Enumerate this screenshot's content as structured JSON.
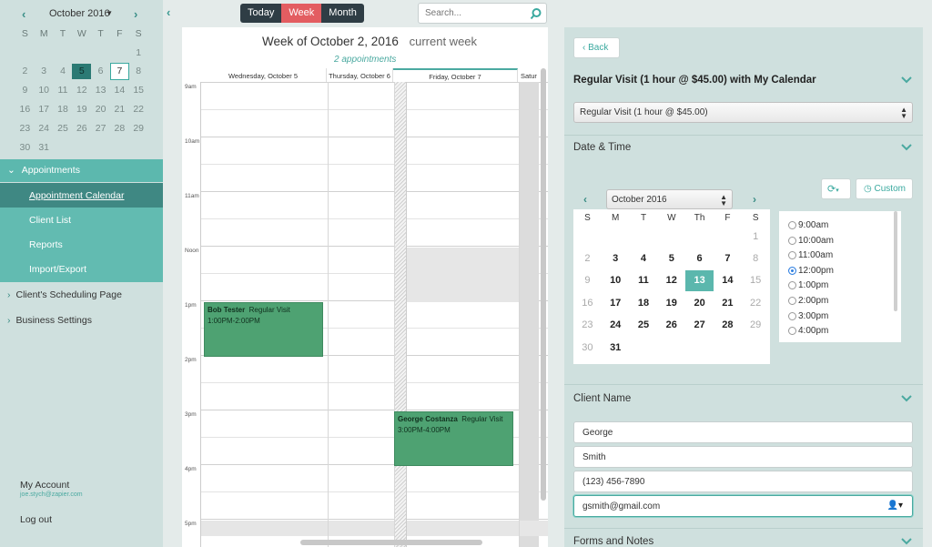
{
  "mini_calendar": {
    "month_label": "October 2016",
    "dow": [
      "S",
      "M",
      "T",
      "W",
      "T",
      "F",
      "S"
    ],
    "weeks": [
      [
        "",
        "",
        "",
        "",
        "",
        "",
        "1"
      ],
      [
        "2",
        "3",
        "4",
        "5",
        "6",
        "7",
        "8"
      ],
      [
        "9",
        "10",
        "11",
        "12",
        "13",
        "14",
        "15"
      ],
      [
        "16",
        "17",
        "18",
        "19",
        "20",
        "21",
        "22"
      ],
      [
        "23",
        "24",
        "25",
        "26",
        "27",
        "28",
        "29"
      ],
      [
        "30",
        "31",
        "",
        "",
        "",
        "",
        ""
      ]
    ],
    "selected_day": "5",
    "today_day": "7"
  },
  "sidebar": {
    "appointments_label": "Appointments",
    "sub_items": [
      "Appointment Calendar",
      "Client List",
      "Reports",
      "Import/Export"
    ],
    "scheduling_page_label": "Client's Scheduling Page",
    "business_settings_label": "Business Settings",
    "my_account_label": "My Account",
    "email": "joe.stych@zapier.com",
    "logout_label": "Log out"
  },
  "toolbar": {
    "today_label": "Today",
    "week_label": "Week",
    "month_label": "Month",
    "search_placeholder": "Search..."
  },
  "calendar": {
    "week_title": "Week of October 2, 2016",
    "current_week_label": "current week",
    "appointments_count": "2 appointments",
    "days": [
      "Wednesday, October 5",
      "Thursday, October 6",
      "Friday, October 7",
      "Satur"
    ],
    "time_labels": [
      "9am",
      "10am",
      "11am",
      "Noon",
      "1pm",
      "2pm",
      "3pm",
      "4pm",
      "5pm"
    ],
    "events": [
      {
        "name": "Bob Tester",
        "type": "Regular Visit",
        "time": "1:00PM-2:00PM"
      },
      {
        "name": "George Costanza",
        "type": "Regular Visit",
        "time": "3:00PM-4:00PM"
      }
    ]
  },
  "booking": {
    "back_label": "Back",
    "service_title": "Regular Visit (1 hour @ $45.00) with My Calendar",
    "service_select_value": "Regular Visit (1 hour @ $45.00)",
    "datetime_title": "Date & Time",
    "custom_label": "Custom",
    "picker_month": "October 2016",
    "picker_dow": [
      "S",
      "M",
      "T",
      "W",
      "Th",
      "F",
      "S"
    ],
    "picker_weeks": [
      [
        "",
        "",
        "",
        "",
        "",
        "",
        "1"
      ],
      [
        "2",
        "3",
        "4",
        "5",
        "6",
        "7",
        "8"
      ],
      [
        "9",
        "10",
        "11",
        "12",
        "13",
        "14",
        "15"
      ],
      [
        "16",
        "17",
        "18",
        "19",
        "20",
        "21",
        "22"
      ],
      [
        "23",
        "24",
        "25",
        "26",
        "27",
        "28",
        "29"
      ],
      [
        "30",
        "31",
        "",
        "",
        "",
        "",
        ""
      ]
    ],
    "available_days": [
      "3",
      "4",
      "5",
      "6",
      "7",
      "10",
      "11",
      "12",
      "13",
      "14",
      "17",
      "18",
      "19",
      "20",
      "21",
      "24",
      "25",
      "26",
      "27",
      "28",
      "31"
    ],
    "selected_day": "13",
    "time_slots": [
      "9:00am",
      "10:00am",
      "11:00am",
      "12:00pm",
      "1:00pm",
      "2:00pm",
      "3:00pm",
      "4:00pm"
    ],
    "selected_slot": "12:00pm",
    "client_name_title": "Client Name",
    "first_name": "George",
    "last_name": "Smith",
    "phone": "(123) 456-7890",
    "email": "gsmith@gmail.com",
    "forms_title": "Forms and Notes"
  },
  "colors": {
    "accent": "#5cb8ae",
    "event": "#4ea272",
    "week_active": "#e35d61",
    "toolbar_dark": "#2f3d45"
  }
}
